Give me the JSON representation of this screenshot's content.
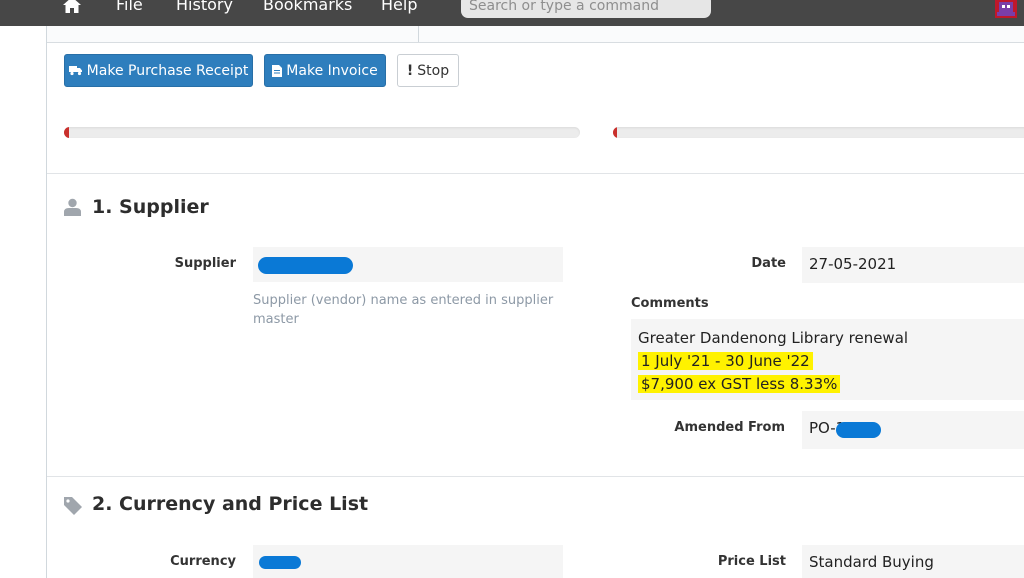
{
  "navbar": {
    "menu": [
      "File",
      "History",
      "Bookmarks",
      "Help"
    ],
    "search_placeholder": "Search or type a command"
  },
  "actions": {
    "purchase_receipt": "Make Purchase Receipt",
    "invoice": "Make Invoice",
    "stop": "Stop"
  },
  "progress": [
    {
      "fraction": 0.01
    },
    {
      "fraction": 0.01
    }
  ],
  "sections": {
    "supplier": {
      "heading": "1. Supplier",
      "supplier_label": "Supplier",
      "supplier_value": "",
      "supplier_help": [
        "Supplier (vendor) name as entered in supplier",
        "master"
      ],
      "date_label": "Date",
      "date_value": "27-05-2021",
      "comments_label": "Comments",
      "comments": [
        "Greater Dandenong Library renewal",
        "1 July '21 - 30 June '22",
        "$7,900 ex GST less 8.33%"
      ],
      "amended_label": "Amended From",
      "amended_value": "PO-1"
    },
    "currency": {
      "heading": "2. Currency and Price List",
      "currency_label": "Currency",
      "currency_value": "",
      "price_list_label": "Price List",
      "price_list_value": "Standard Buying"
    }
  },
  "colors": {
    "navbar": "#474747",
    "primary_button": "#2e7ebd",
    "progress_fill": "#c9302c",
    "highlight": "#fff200",
    "redaction": "#0a79d6"
  },
  "icons": {
    "home": "home-icon",
    "truck": "truck-icon",
    "file": "file-icon",
    "exclamation": "exclamation-icon",
    "user": "user-icon",
    "tag": "tag-icon"
  }
}
